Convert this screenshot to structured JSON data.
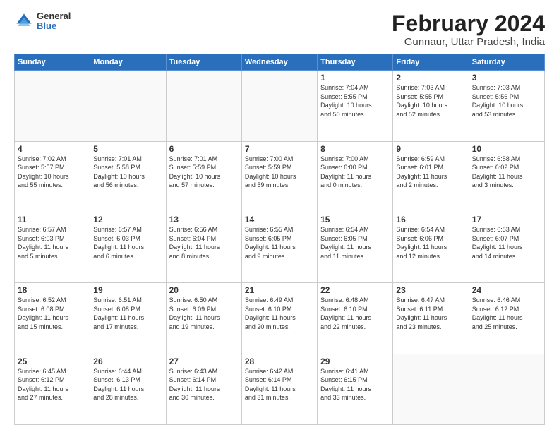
{
  "logo": {
    "general": "General",
    "blue": "Blue"
  },
  "header": {
    "month": "February 2024",
    "location": "Gunnaur, Uttar Pradesh, India"
  },
  "weekdays": [
    "Sunday",
    "Monday",
    "Tuesday",
    "Wednesday",
    "Thursday",
    "Friday",
    "Saturday"
  ],
  "weeks": [
    [
      {
        "day": "",
        "info": ""
      },
      {
        "day": "",
        "info": ""
      },
      {
        "day": "",
        "info": ""
      },
      {
        "day": "",
        "info": ""
      },
      {
        "day": "1",
        "info": "Sunrise: 7:04 AM\nSunset: 5:55 PM\nDaylight: 10 hours\nand 50 minutes."
      },
      {
        "day": "2",
        "info": "Sunrise: 7:03 AM\nSunset: 5:55 PM\nDaylight: 10 hours\nand 52 minutes."
      },
      {
        "day": "3",
        "info": "Sunrise: 7:03 AM\nSunset: 5:56 PM\nDaylight: 10 hours\nand 53 minutes."
      }
    ],
    [
      {
        "day": "4",
        "info": "Sunrise: 7:02 AM\nSunset: 5:57 PM\nDaylight: 10 hours\nand 55 minutes."
      },
      {
        "day": "5",
        "info": "Sunrise: 7:01 AM\nSunset: 5:58 PM\nDaylight: 10 hours\nand 56 minutes."
      },
      {
        "day": "6",
        "info": "Sunrise: 7:01 AM\nSunset: 5:59 PM\nDaylight: 10 hours\nand 57 minutes."
      },
      {
        "day": "7",
        "info": "Sunrise: 7:00 AM\nSunset: 5:59 PM\nDaylight: 10 hours\nand 59 minutes."
      },
      {
        "day": "8",
        "info": "Sunrise: 7:00 AM\nSunset: 6:00 PM\nDaylight: 11 hours\nand 0 minutes."
      },
      {
        "day": "9",
        "info": "Sunrise: 6:59 AM\nSunset: 6:01 PM\nDaylight: 11 hours\nand 2 minutes."
      },
      {
        "day": "10",
        "info": "Sunrise: 6:58 AM\nSunset: 6:02 PM\nDaylight: 11 hours\nand 3 minutes."
      }
    ],
    [
      {
        "day": "11",
        "info": "Sunrise: 6:57 AM\nSunset: 6:03 PM\nDaylight: 11 hours\nand 5 minutes."
      },
      {
        "day": "12",
        "info": "Sunrise: 6:57 AM\nSunset: 6:03 PM\nDaylight: 11 hours\nand 6 minutes."
      },
      {
        "day": "13",
        "info": "Sunrise: 6:56 AM\nSunset: 6:04 PM\nDaylight: 11 hours\nand 8 minutes."
      },
      {
        "day": "14",
        "info": "Sunrise: 6:55 AM\nSunset: 6:05 PM\nDaylight: 11 hours\nand 9 minutes."
      },
      {
        "day": "15",
        "info": "Sunrise: 6:54 AM\nSunset: 6:05 PM\nDaylight: 11 hours\nand 11 minutes."
      },
      {
        "day": "16",
        "info": "Sunrise: 6:54 AM\nSunset: 6:06 PM\nDaylight: 11 hours\nand 12 minutes."
      },
      {
        "day": "17",
        "info": "Sunrise: 6:53 AM\nSunset: 6:07 PM\nDaylight: 11 hours\nand 14 minutes."
      }
    ],
    [
      {
        "day": "18",
        "info": "Sunrise: 6:52 AM\nSunset: 6:08 PM\nDaylight: 11 hours\nand 15 minutes."
      },
      {
        "day": "19",
        "info": "Sunrise: 6:51 AM\nSunset: 6:08 PM\nDaylight: 11 hours\nand 17 minutes."
      },
      {
        "day": "20",
        "info": "Sunrise: 6:50 AM\nSunset: 6:09 PM\nDaylight: 11 hours\nand 19 minutes."
      },
      {
        "day": "21",
        "info": "Sunrise: 6:49 AM\nSunset: 6:10 PM\nDaylight: 11 hours\nand 20 minutes."
      },
      {
        "day": "22",
        "info": "Sunrise: 6:48 AM\nSunset: 6:10 PM\nDaylight: 11 hours\nand 22 minutes."
      },
      {
        "day": "23",
        "info": "Sunrise: 6:47 AM\nSunset: 6:11 PM\nDaylight: 11 hours\nand 23 minutes."
      },
      {
        "day": "24",
        "info": "Sunrise: 6:46 AM\nSunset: 6:12 PM\nDaylight: 11 hours\nand 25 minutes."
      }
    ],
    [
      {
        "day": "25",
        "info": "Sunrise: 6:45 AM\nSunset: 6:12 PM\nDaylight: 11 hours\nand 27 minutes."
      },
      {
        "day": "26",
        "info": "Sunrise: 6:44 AM\nSunset: 6:13 PM\nDaylight: 11 hours\nand 28 minutes."
      },
      {
        "day": "27",
        "info": "Sunrise: 6:43 AM\nSunset: 6:14 PM\nDaylight: 11 hours\nand 30 minutes."
      },
      {
        "day": "28",
        "info": "Sunrise: 6:42 AM\nSunset: 6:14 PM\nDaylight: 11 hours\nand 31 minutes."
      },
      {
        "day": "29",
        "info": "Sunrise: 6:41 AM\nSunset: 6:15 PM\nDaylight: 11 hours\nand 33 minutes."
      },
      {
        "day": "",
        "info": ""
      },
      {
        "day": "",
        "info": ""
      }
    ]
  ]
}
